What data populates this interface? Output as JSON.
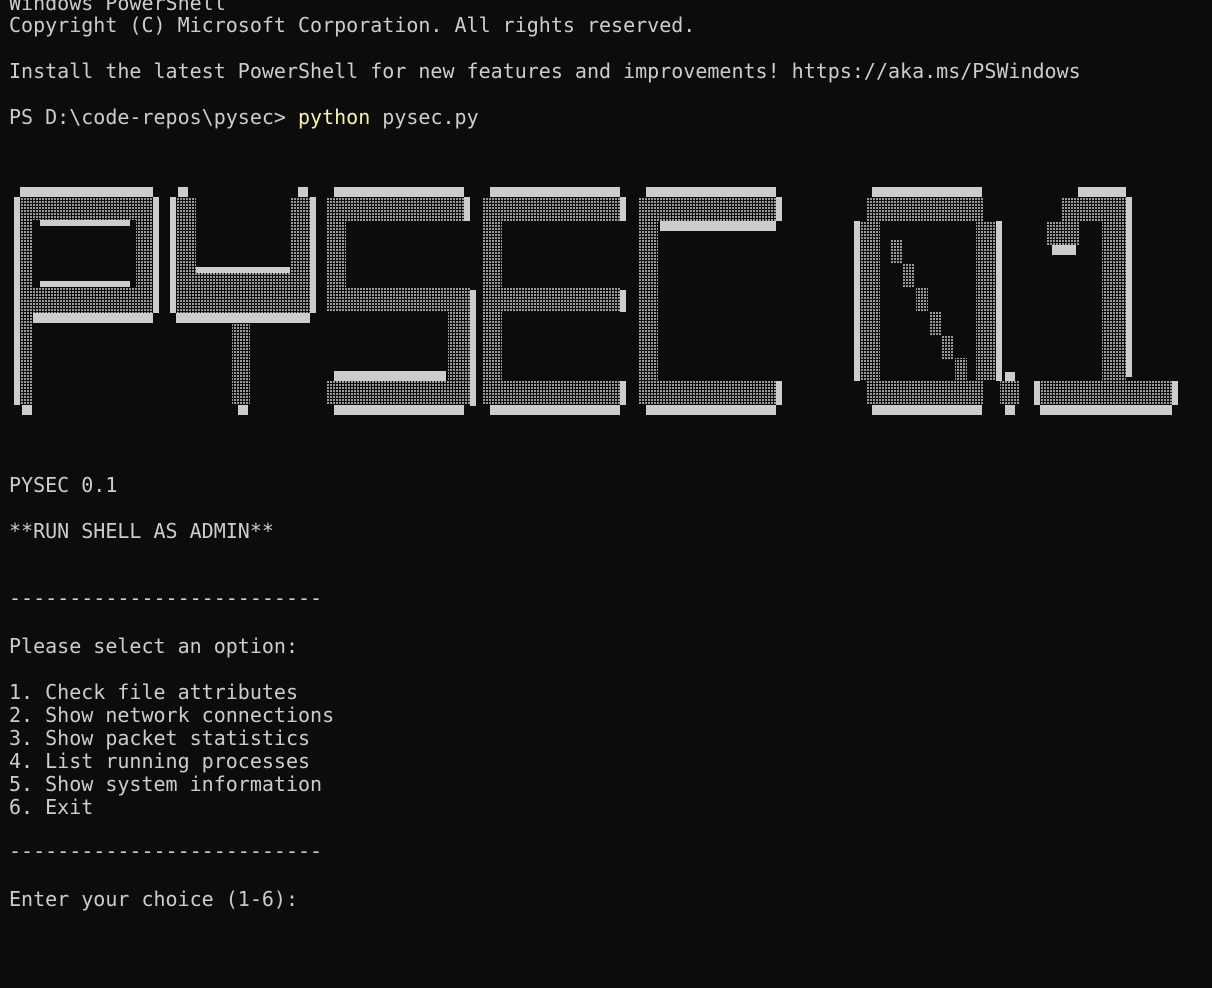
{
  "terminal": {
    "header_line1": "Windows PowerShell",
    "header_line2": "Copyright (C) Microsoft Corporation. All rights reserved.",
    "install_msg": "Install the latest PowerShell for new features and improvements! https://aka.ms/PSWindows",
    "prompt": "PS D:\\code-repos\\pysec> ",
    "command_keyword": "python",
    "command_args": " pysec.py"
  },
  "banner": {
    "ascii_art_text": "PYSEC 0.1"
  },
  "app": {
    "title": "PYSEC 0.1",
    "admin_notice": "**RUN SHELL AS ADMIN**",
    "separator": "--------------------------",
    "menu_prompt": "Please select an option:",
    "options": [
      "1. Check file attributes",
      "2. Show network connections",
      "3. Show packet statistics",
      "4. List running processes",
      "5. Show system information",
      "6. Exit"
    ],
    "input_prompt": "Enter your choice (1-6): "
  },
  "colors": {
    "background": "#0c0c0c",
    "foreground": "#cccccc",
    "command_keyword": "#f9f1a5"
  }
}
